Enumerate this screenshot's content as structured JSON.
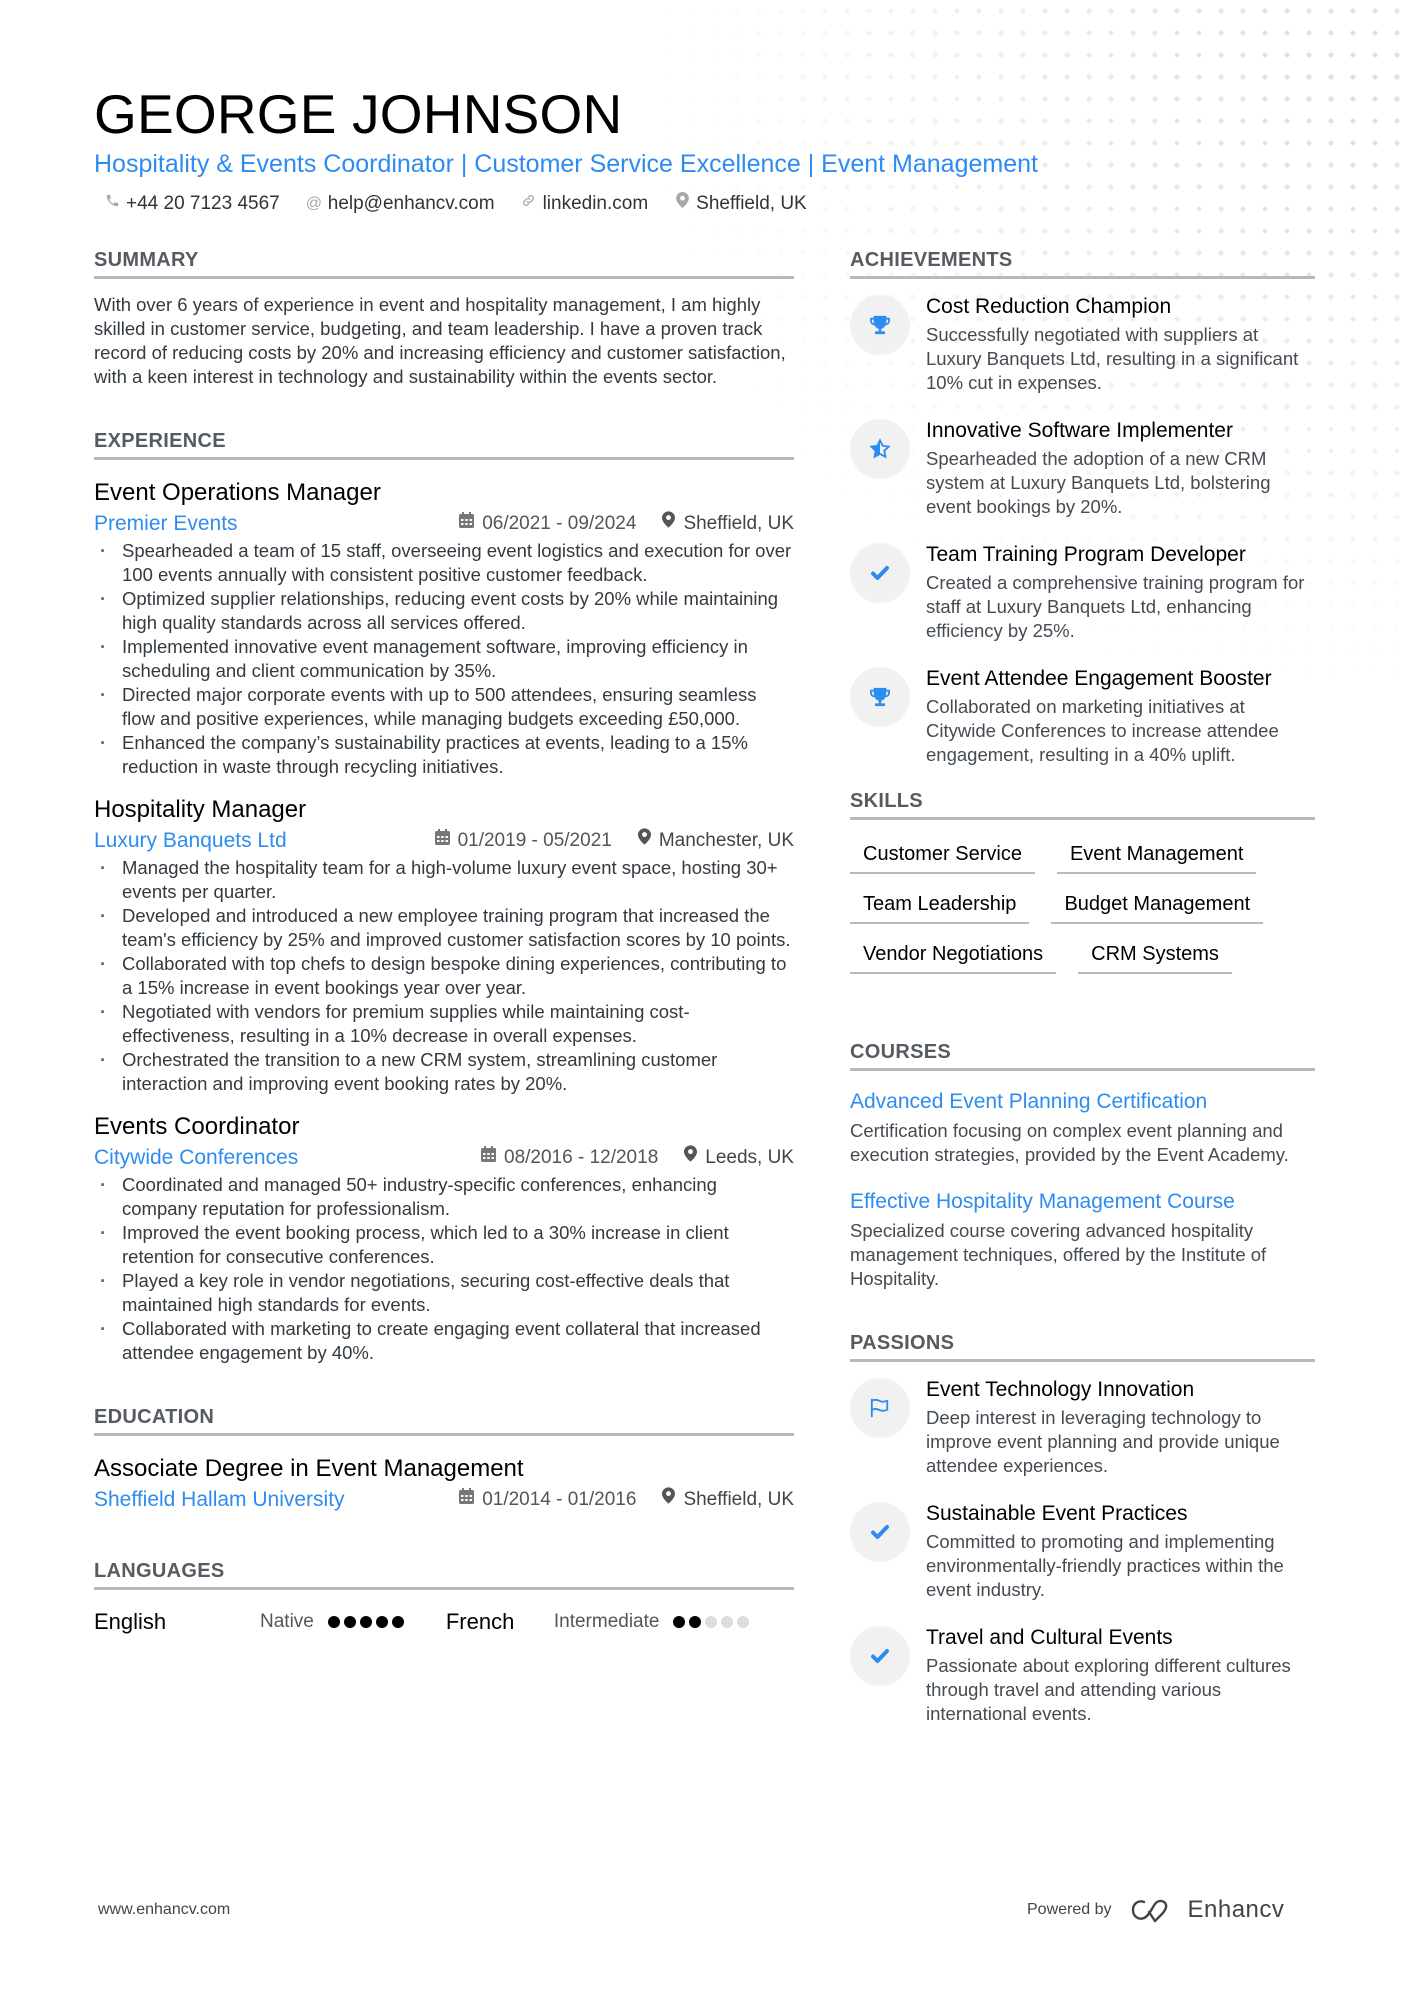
{
  "header": {
    "name": "GEORGE JOHNSON",
    "headline": "Hospitality & Events Coordinator | Customer Service Excellence | Event Management",
    "contacts": [
      {
        "icon": "phone-icon",
        "text": "+44 20 7123 4567"
      },
      {
        "icon": "at-icon",
        "text": "help@enhancv.com"
      },
      {
        "icon": "link-icon",
        "text": "linkedin.com"
      },
      {
        "icon": "location-icon",
        "text": "Sheffield, UK"
      }
    ]
  },
  "summary": {
    "title": "SUMMARY",
    "text": "With over 6 years of experience in event and hospitality management, I am highly skilled in customer service, budgeting, and team leadership. I have a proven track record of reducing costs by 20% and increasing efficiency and customer satisfaction, with a keen interest in technology and sustainability within the events sector."
  },
  "experience": {
    "title": "EXPERIENCE",
    "jobs": [
      {
        "title": "Event Operations Manager",
        "company": "Premier Events",
        "dates": "06/2021 - 09/2024",
        "location": "Sheffield, UK",
        "bullets": [
          "Spearheaded a team of 15 staff, overseeing event logistics and execution for over 100 events annually with consistent positive customer feedback.",
          "Optimized supplier relationships, reducing event costs by 20% while maintaining high quality standards across all services offered.",
          "Implemented innovative event management software, improving efficiency in scheduling and client communication by 35%.",
          "Directed major corporate events with up to 500 attendees, ensuring seamless flow and positive experiences, while managing budgets exceeding £50,000.",
          "Enhanced the company’s sustainability practices at events, leading to a 15% reduction in waste through recycling initiatives."
        ]
      },
      {
        "title": "Hospitality Manager",
        "company": "Luxury Banquets Ltd",
        "dates": "01/2019 - 05/2021",
        "location": "Manchester, UK",
        "bullets": [
          "Managed the hospitality team for a high-volume luxury event space, hosting 30+ events per quarter.",
          "Developed and introduced a new employee training program that increased the team's efficiency by 25% and improved customer satisfaction scores by 10 points.",
          "Collaborated with top chefs to design bespoke dining experiences, contributing to a 15% increase in event bookings year over year.",
          "Negotiated with vendors for premium supplies while maintaining cost-effectiveness, resulting in a 10% decrease in overall expenses.",
          "Orchestrated the transition to a new CRM system, streamlining customer interaction and improving event booking rates by 20%."
        ]
      },
      {
        "title": "Events Coordinator",
        "company": "Citywide Conferences",
        "dates": "08/2016 - 12/2018",
        "location": "Leeds, UK",
        "bullets": [
          "Coordinated and managed 50+ industry-specific conferences, enhancing company reputation for professionalism.",
          "Improved the event booking process, which led to a 30% increase in client retention for consecutive conferences.",
          "Played a key role in vendor negotiations, securing cost-effective deals that maintained high standards for events.",
          "Collaborated with marketing to create engaging event collateral that increased attendee engagement by 40%."
        ]
      }
    ]
  },
  "education": {
    "title": "EDUCATION",
    "items": [
      {
        "degree": "Associate Degree in Event Management",
        "school": "Sheffield Hallam University",
        "dates": "01/2014 - 01/2016",
        "location": "Sheffield, UK"
      }
    ]
  },
  "languages": {
    "title": "LANGUAGES",
    "items": [
      {
        "name": "English",
        "level": "Native",
        "rating": 5,
        "max": 5
      },
      {
        "name": "French",
        "level": "Intermediate",
        "rating": 2,
        "max": 5
      }
    ]
  },
  "achievements": {
    "title": "ACHIEVEMENTS",
    "items": [
      {
        "icon": "trophy-icon",
        "title": "Cost Reduction Champion",
        "desc": "Successfully negotiated with suppliers at Luxury Banquets Ltd, resulting in a significant 10% cut in expenses."
      },
      {
        "icon": "star-icon",
        "title": "Innovative Software Implementer",
        "desc": "Spearheaded the adoption of a new CRM system at Luxury Banquets Ltd, bolstering event bookings by 20%."
      },
      {
        "icon": "check-icon",
        "title": "Team Training Program Developer",
        "desc": "Created a comprehensive training program for staff at Luxury Banquets Ltd, enhancing efficiency by 25%."
      },
      {
        "icon": "trophy-icon",
        "title": "Event Attendee Engagement Booster",
        "desc": "Collaborated on marketing initiatives at Citywide Conferences to increase attendee engagement, resulting in a 40% uplift."
      }
    ]
  },
  "skills": {
    "title": "SKILLS",
    "items": [
      "Customer Service",
      "Event Management",
      "Team Leadership",
      "Budget Management",
      "Vendor Negotiations",
      "CRM Systems"
    ]
  },
  "courses": {
    "title": "COURSES",
    "items": [
      {
        "title": "Advanced Event Planning Certification",
        "desc": "Certification focusing on complex event planning and execution strategies, provided by the Event Academy."
      },
      {
        "title": "Effective Hospitality Management Course",
        "desc": "Specialized course covering advanced hospitality management techniques, offered by the Institute of Hospitality."
      }
    ]
  },
  "passions": {
    "title": "PASSIONS",
    "items": [
      {
        "icon": "flag-icon",
        "title": "Event Technology Innovation",
        "desc": "Deep interest in leveraging technology to improve event planning and provide unique attendee experiences."
      },
      {
        "icon": "check-icon",
        "title": "Sustainable Event Practices",
        "desc": "Committed to promoting and implementing environmentally-friendly practices within the event industry."
      },
      {
        "icon": "check-icon",
        "title": "Travel and Cultural Events",
        "desc": "Passionate about exploring different cultures through travel and attending various international events."
      }
    ]
  },
  "footer": {
    "website": "www.enhancv.com",
    "powered_by": "Powered by",
    "brand": "Enhancv"
  },
  "colors": {
    "accent": "#2d8cf0",
    "text": "#333a40",
    "rule": "#b7babd"
  }
}
